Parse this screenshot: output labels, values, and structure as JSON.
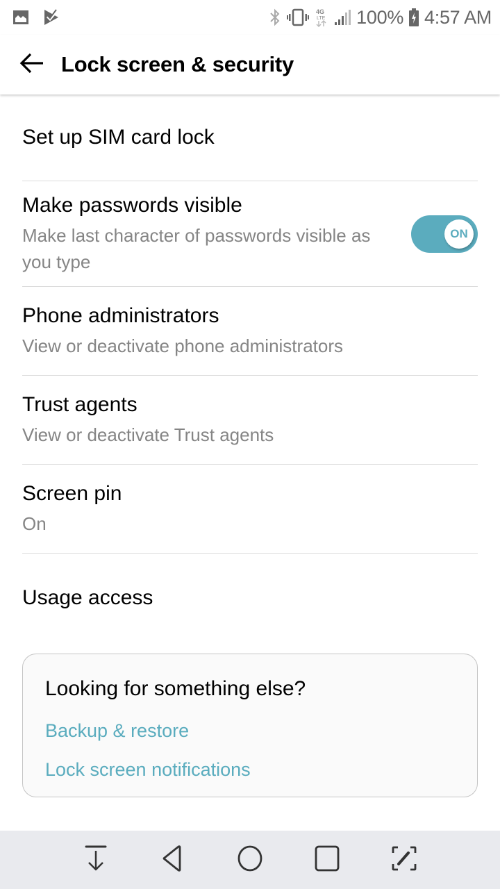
{
  "status_bar": {
    "left_icons": [
      "gallery-icon",
      "play-store-check-icon"
    ],
    "right_icons": [
      "bluetooth-icon",
      "vibrate-icon",
      "4g-lte-icon",
      "signal-icon"
    ],
    "battery_percent": "100%",
    "battery_icon": "battery-charging-icon",
    "time": "4:57 AM"
  },
  "app_bar": {
    "back_icon": "arrow-left-icon",
    "title": "Lock screen & security"
  },
  "settings": [
    {
      "title": "Set up SIM card lock"
    },
    {
      "title": "Make passwords visible",
      "subtitle": "Make last character of passwords visible as you type",
      "toggle": {
        "state": "on",
        "label": "ON"
      }
    },
    {
      "title": "Phone administrators",
      "subtitle": "View or deactivate phone administrators"
    },
    {
      "title": "Trust agents",
      "subtitle": "View or deactivate Trust agents"
    },
    {
      "title": "Screen pin",
      "subtitle": "On"
    },
    {
      "title": "Usage access"
    }
  ],
  "suggestion_card": {
    "title": "Looking for something else?",
    "links": [
      "Backup & restore",
      "Lock screen notifications"
    ]
  },
  "nav_bar": {
    "buttons": [
      "notification-pull-down-icon",
      "back-triangle-icon",
      "home-circle-icon",
      "recents-square-icon",
      "capture-plus-icon"
    ]
  },
  "colors": {
    "accent": "#5bacbe",
    "subtitle": "#858585",
    "nav_bg": "#e9eaee"
  }
}
